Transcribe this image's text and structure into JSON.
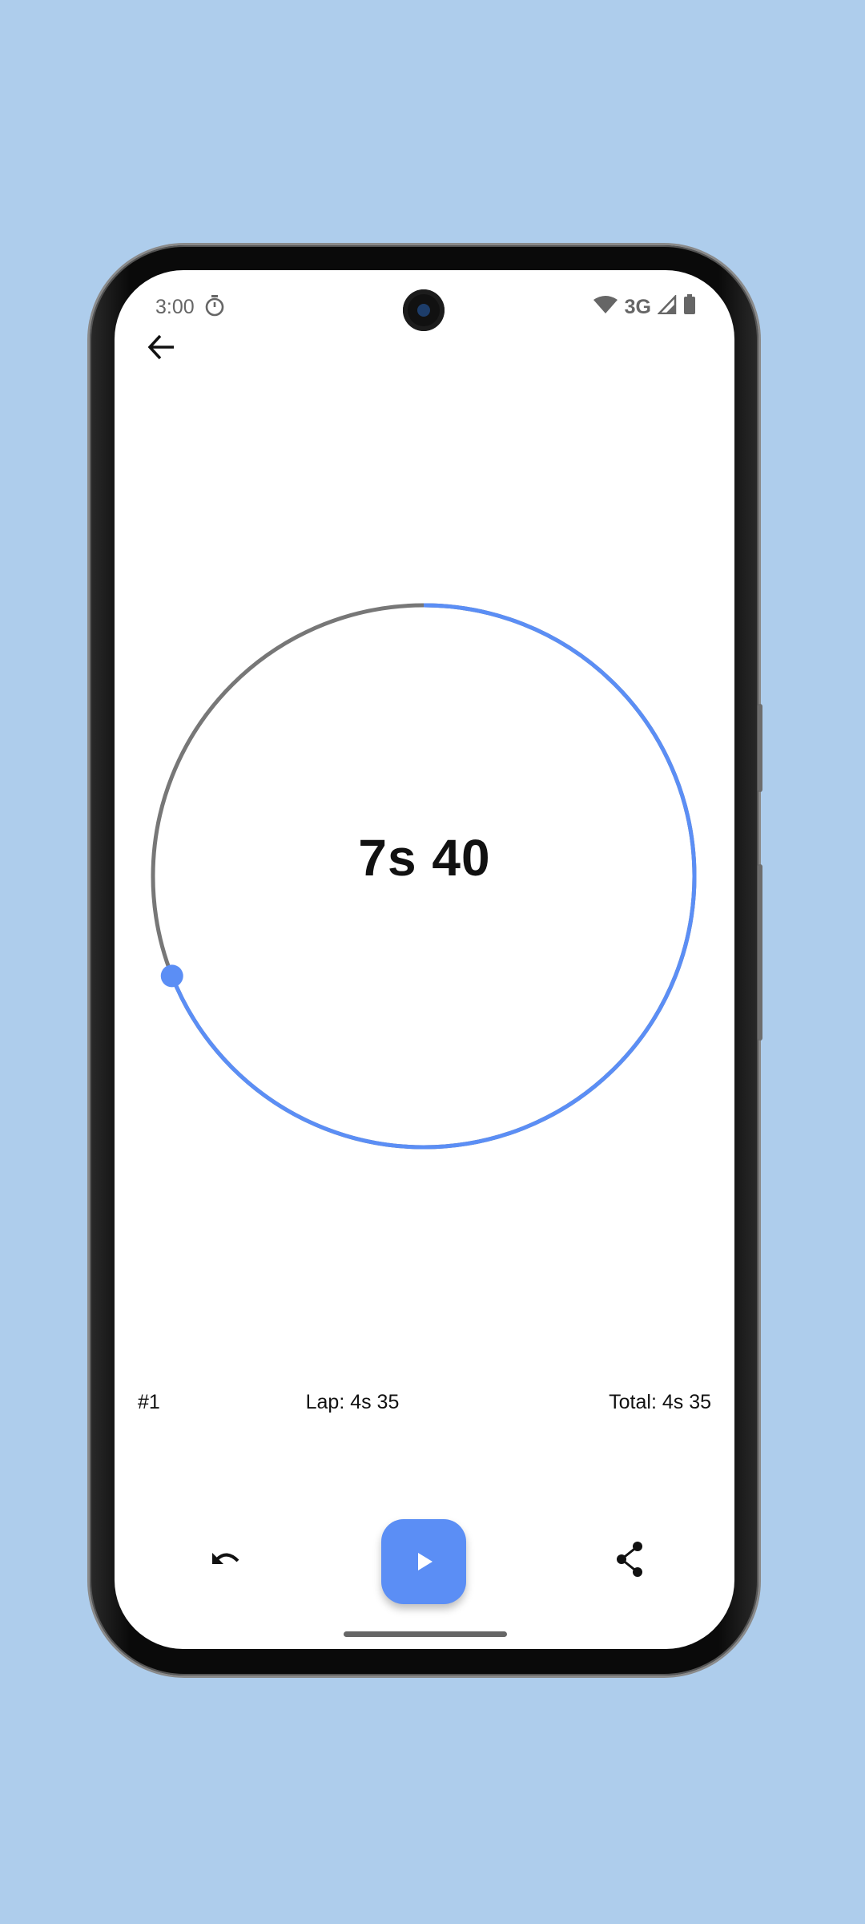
{
  "status_bar": {
    "time": "3:00",
    "network": "3G",
    "icons": [
      "stopwatch-icon",
      "wifi-icon",
      "signal-icon",
      "battery-icon"
    ]
  },
  "toolbar": {
    "back_icon": "arrow-left-icon"
  },
  "stopwatch": {
    "elapsed_display": "7s 40",
    "dial_progress_fraction": 0.69,
    "accent_color": "#5b8ef5",
    "track_color": "#777777"
  },
  "laps": [
    {
      "number": "#1",
      "lap": "Lap: 4s 35",
      "total": "Total: 4s 35"
    }
  ],
  "controls": {
    "reset_icon": "undo-icon",
    "play_icon": "play-icon",
    "share_icon": "share-icon"
  }
}
